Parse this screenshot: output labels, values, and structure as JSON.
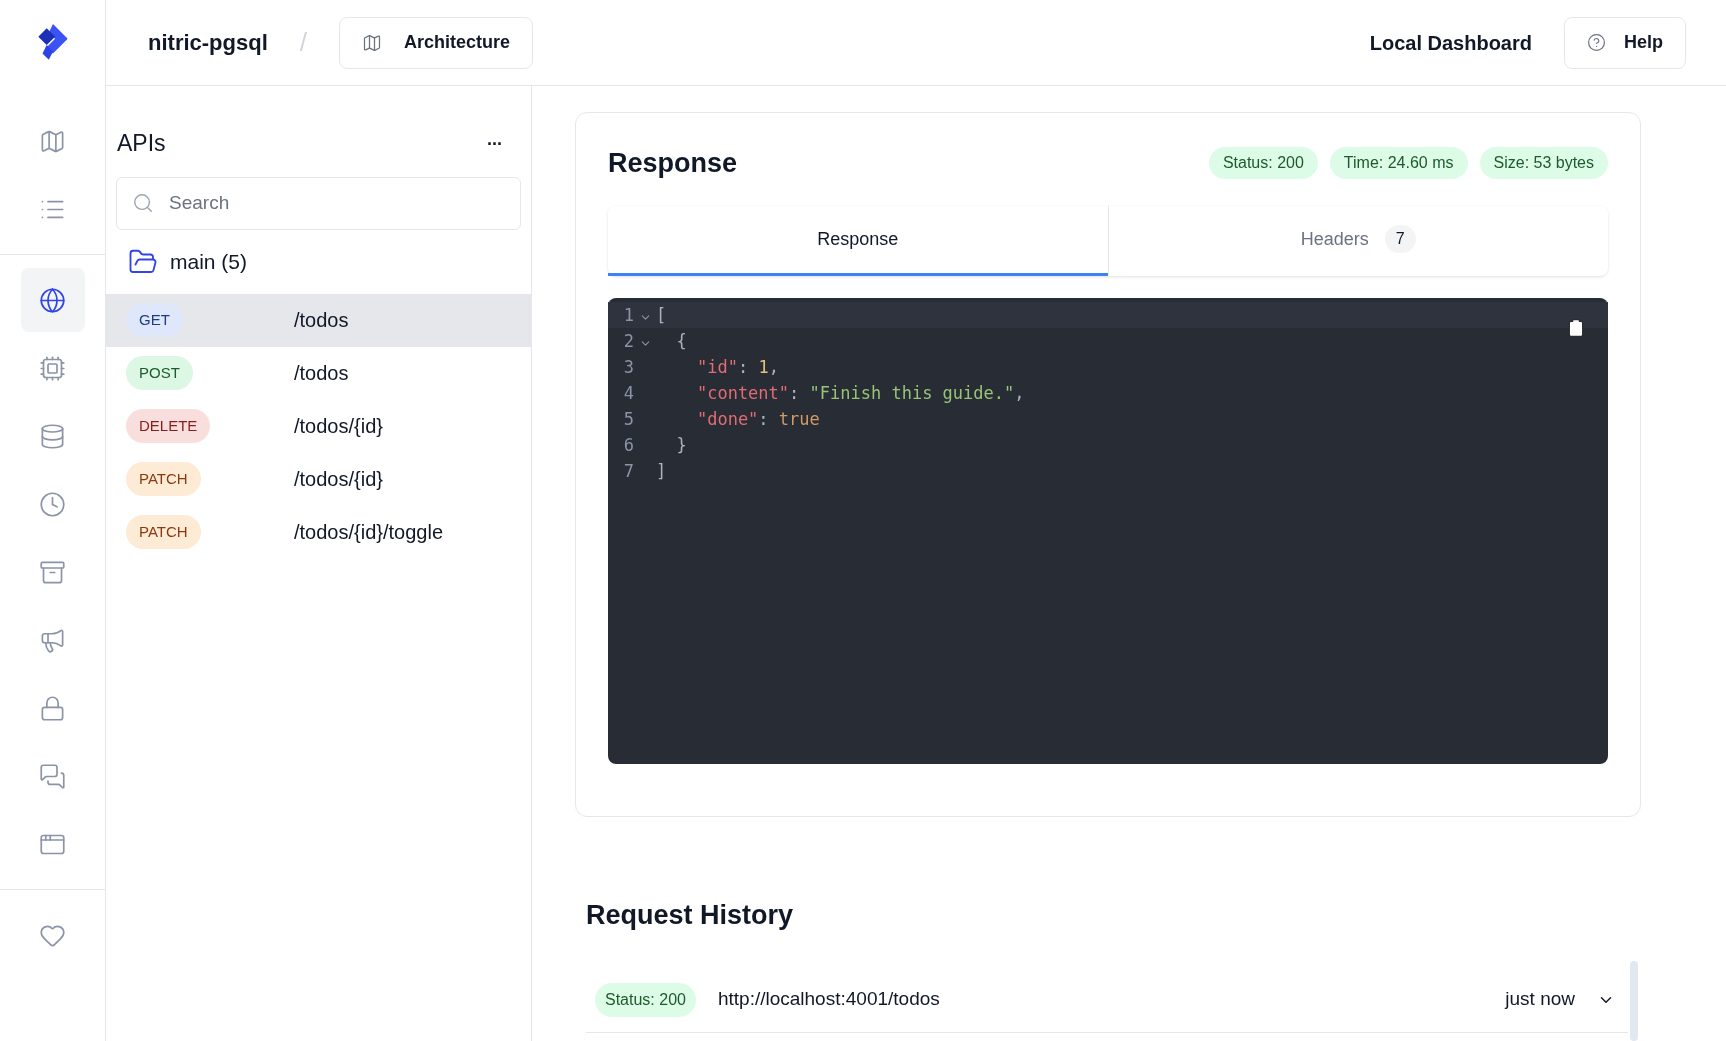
{
  "header": {
    "project": "nitric-pgsql",
    "separator": "/",
    "architecture_button": "Architecture",
    "dashboard_title": "Local Dashboard",
    "help_button": "Help"
  },
  "rail": [
    {
      "kind": "map",
      "selected": false
    },
    {
      "kind": "list",
      "selected": false
    },
    {
      "kind": "divider"
    },
    {
      "kind": "globe",
      "selected": true
    },
    {
      "kind": "cpu",
      "selected": false
    },
    {
      "kind": "database",
      "selected": false
    },
    {
      "kind": "clock",
      "selected": false
    },
    {
      "kind": "archive",
      "selected": false
    },
    {
      "kind": "megaphone",
      "selected": false
    },
    {
      "kind": "lock",
      "selected": false
    },
    {
      "kind": "chat",
      "selected": false
    },
    {
      "kind": "window",
      "selected": false
    },
    {
      "kind": "divider"
    },
    {
      "kind": "heart",
      "selected": false
    }
  ],
  "apis": {
    "title": "APIs",
    "more": "...",
    "search": {
      "placeholder": "Search"
    },
    "group": "main (5)",
    "routes": [
      {
        "method": "GET",
        "path": "/todos",
        "selected": true
      },
      {
        "method": "POST",
        "path": "/todos",
        "selected": false
      },
      {
        "method": "DELETE",
        "path": "/todos/{id}",
        "selected": false
      },
      {
        "method": "PATCH",
        "path": "/todos/{id}",
        "selected": false
      },
      {
        "method": "PATCH",
        "path": "/todos/{id}/toggle",
        "selected": false
      }
    ]
  },
  "response": {
    "title": "Response",
    "badges": [
      "Status: 200",
      "Time: 24.60 ms",
      "Size: 53 bytes"
    ],
    "tabs": [
      {
        "label": "Response",
        "selected": true
      },
      {
        "label": "Headers",
        "count": "7",
        "selected": false
      }
    ],
    "code": [
      {
        "number": "1",
        "foldable": true,
        "tokens": [
          {
            "kind": "punct",
            "text": "["
          }
        ]
      },
      {
        "number": "2",
        "foldable": true,
        "tokens": [
          {
            "kind": "punct",
            "text": "  {"
          }
        ]
      },
      {
        "number": "3",
        "foldable": false,
        "tokens": [
          {
            "kind": "key",
            "text": "    \"id\""
          },
          {
            "kind": "punct",
            "text": ": "
          },
          {
            "kind": "number",
            "text": "1"
          },
          {
            "kind": "punct",
            "text": ","
          }
        ]
      },
      {
        "number": "4",
        "foldable": false,
        "tokens": [
          {
            "kind": "key",
            "text": "    \"content\""
          },
          {
            "kind": "punct",
            "text": ": "
          },
          {
            "kind": "string",
            "text": "\"Finish this guide.\""
          },
          {
            "kind": "punct",
            "text": ","
          }
        ]
      },
      {
        "number": "5",
        "foldable": false,
        "tokens": [
          {
            "kind": "key",
            "text": "    \"done\""
          },
          {
            "kind": "punct",
            "text": ": "
          },
          {
            "kind": "bool",
            "text": "true"
          }
        ]
      },
      {
        "number": "6",
        "foldable": false,
        "tokens": [
          {
            "kind": "punct",
            "text": "  }"
          }
        ]
      },
      {
        "number": "7",
        "foldable": false,
        "tokens": [
          {
            "kind": "punct",
            "text": "]"
          }
        ]
      }
    ]
  },
  "history": {
    "title": "Request History",
    "rows": [
      {
        "status": "Status: 200",
        "url": "http://localhost:4001/todos",
        "time": "just now"
      }
    ]
  }
}
